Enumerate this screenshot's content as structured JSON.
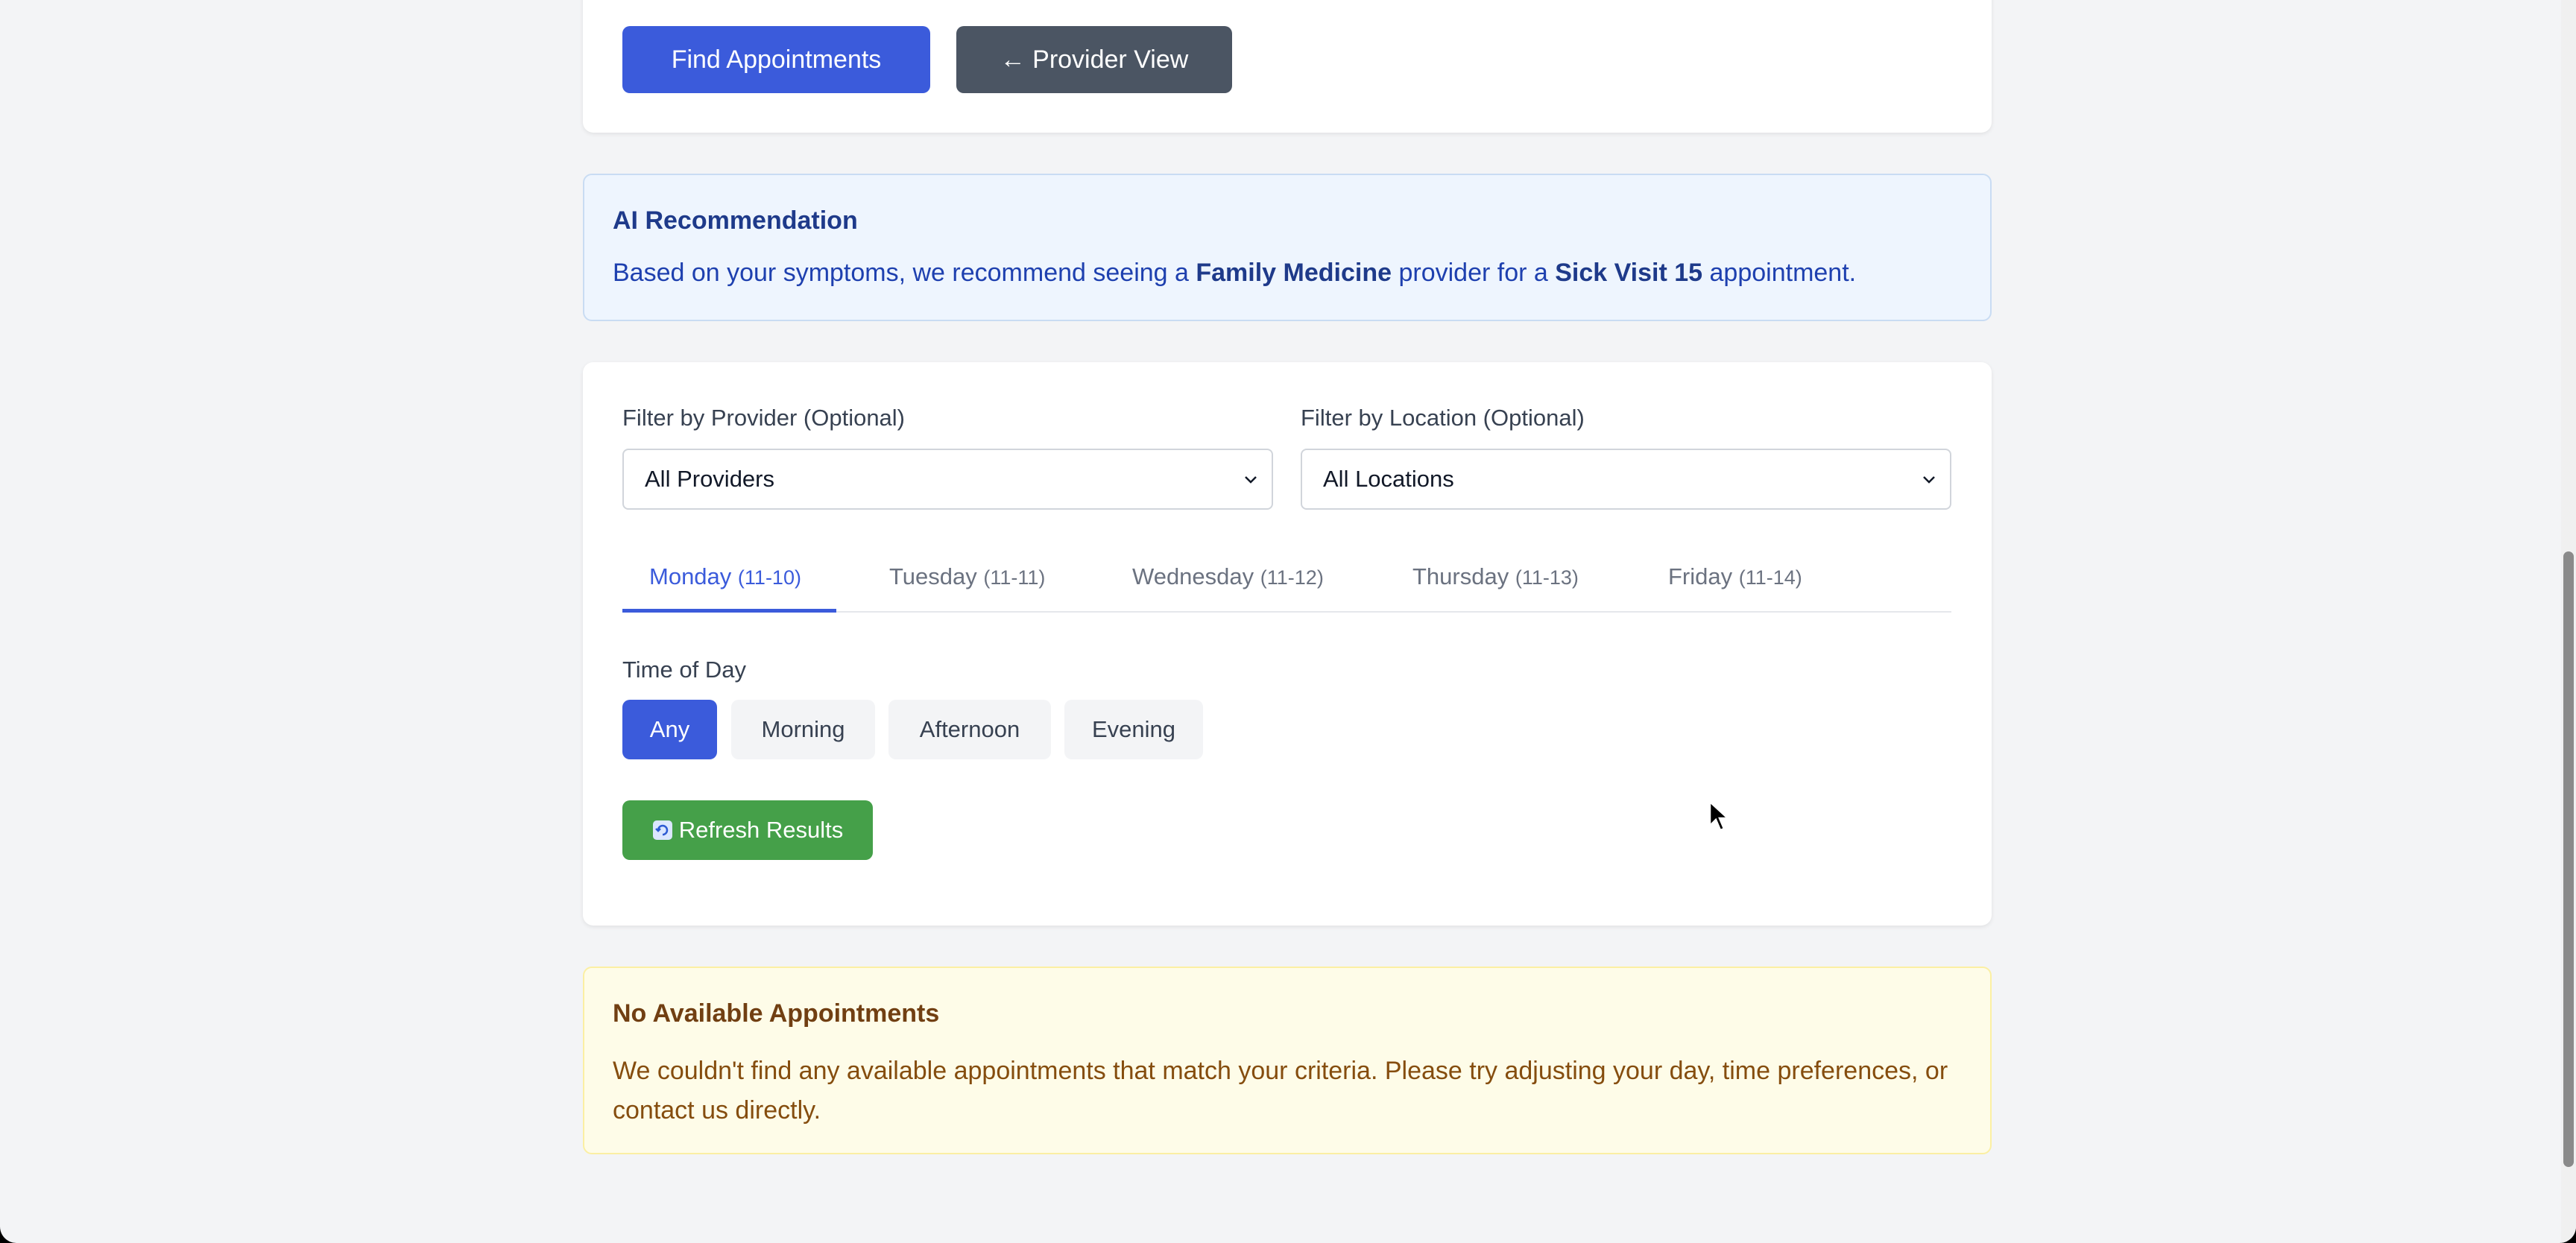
{
  "actions": {
    "find_label": "Find Appointments",
    "provider_view_label": "← Provider View"
  },
  "recommendation": {
    "title": "AI Recommendation",
    "text_pre": "Based on your symptoms, we recommend seeing a ",
    "specialty": "Family Medicine",
    "text_mid": " provider for a ",
    "visit_type": "Sick Visit 15",
    "text_post": " appointment."
  },
  "filters": {
    "provider_label": "Filter by Provider (Optional)",
    "provider_value": "All Providers",
    "location_label": "Filter by Location (Optional)",
    "location_value": "All Locations"
  },
  "days": [
    {
      "name": "Monday",
      "date": "(11-10)"
    },
    {
      "name": "Tuesday",
      "date": "(11-11)"
    },
    {
      "name": "Wednesday",
      "date": "(11-12)"
    },
    {
      "name": "Thursday",
      "date": "(11-13)"
    },
    {
      "name": "Friday",
      "date": "(11-14)"
    }
  ],
  "active_day_index": 0,
  "time_of_day": {
    "label": "Time of Day",
    "options": [
      "Any",
      "Morning",
      "Afternoon",
      "Evening"
    ],
    "selected": "Any"
  },
  "refresh": {
    "icon": "refresh-icon",
    "label": "Refresh Results"
  },
  "no_results": {
    "title": "No Available Appointments",
    "text": "We couldn't find any available appointments that match your criteria. Please try adjusting your day, time preferences, or contact us directly."
  },
  "colors": {
    "primary": "#3b5bdb",
    "dark_button": "#4b5563",
    "success": "#45a049",
    "info_bg": "#eef5fe",
    "warning_bg": "#fefce8"
  }
}
